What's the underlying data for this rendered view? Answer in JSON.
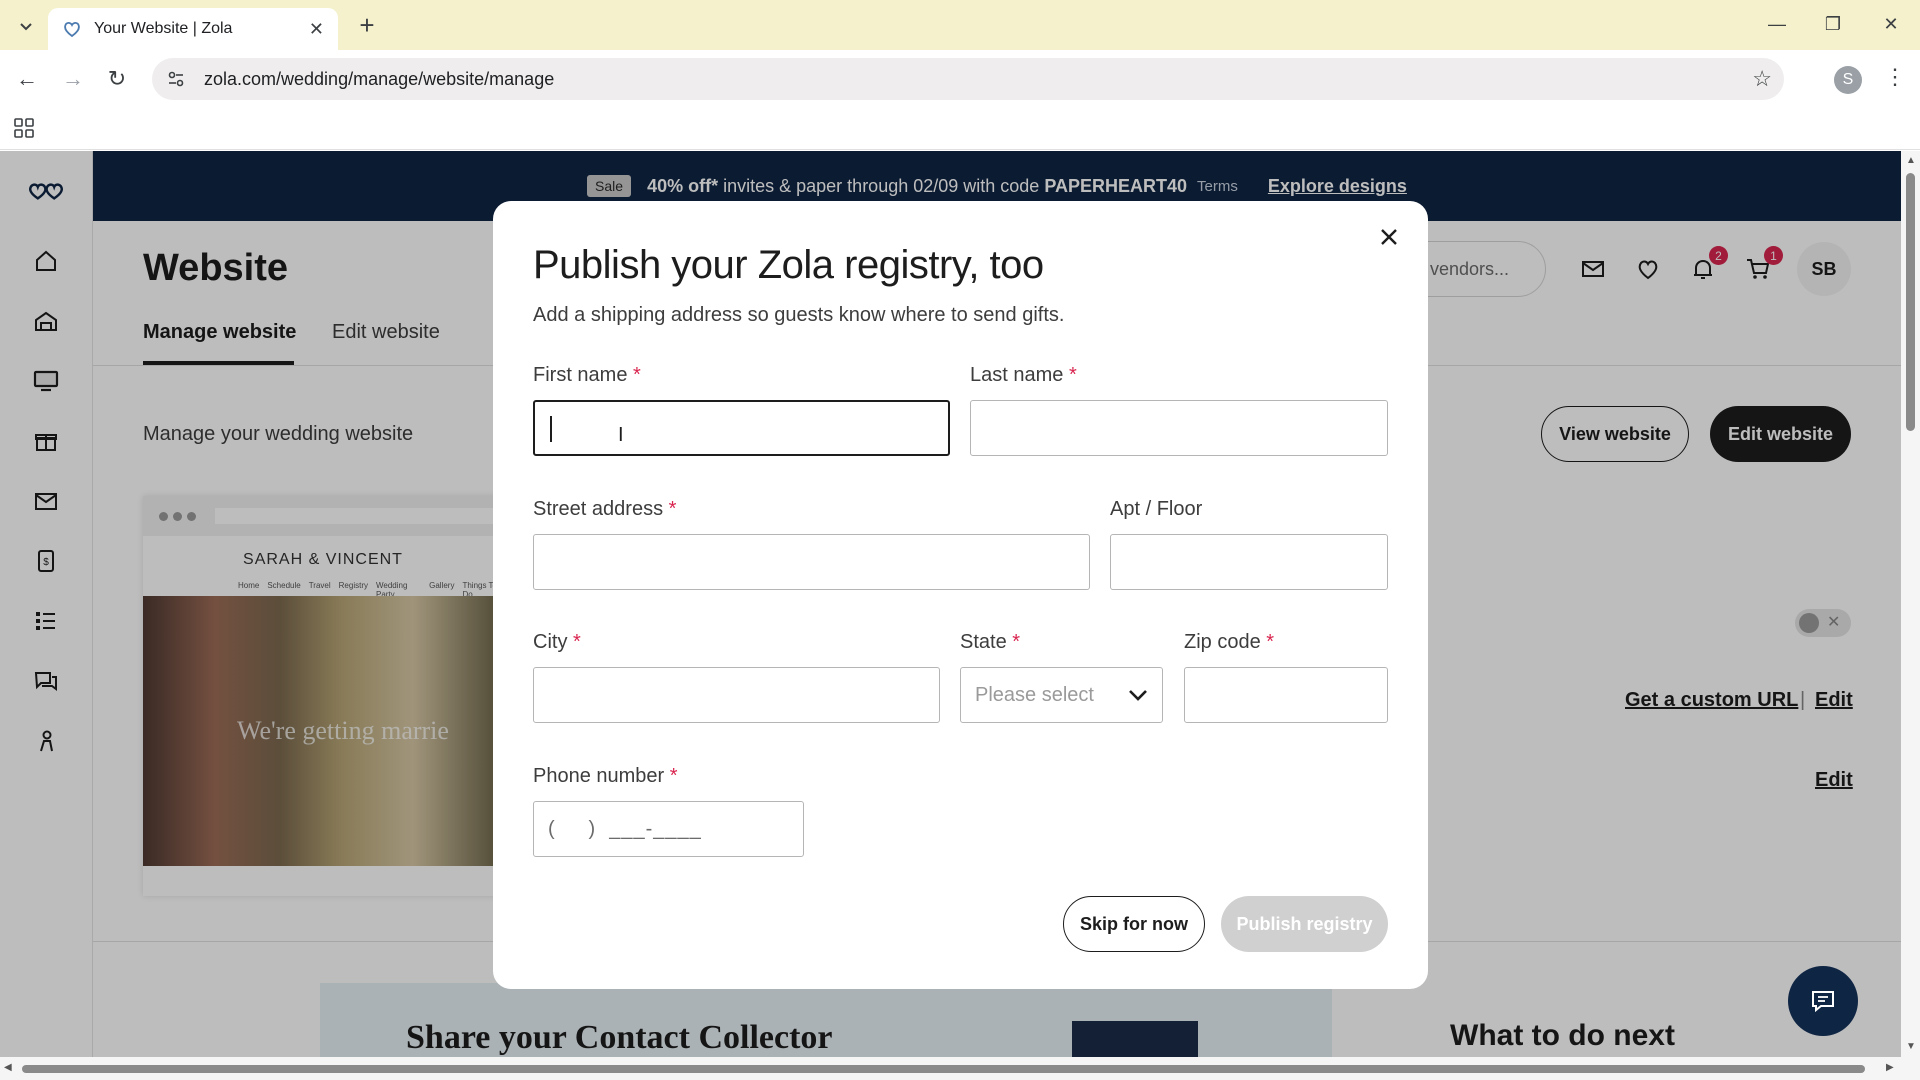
{
  "browser": {
    "tab_title": "Your Website | Zola",
    "url": "zola.com/wedding/manage/website/manage",
    "profile_initial": "S"
  },
  "promo": {
    "sale_badge": "Sale",
    "offer": "40% off*",
    "offer_rest": "invites & paper through 02/09 with code",
    "code": "PAPERHEART40",
    "terms": "Terms",
    "cta": "Explore designs"
  },
  "page": {
    "title": "Website",
    "tabs": [
      {
        "label": "Manage website"
      },
      {
        "label": "Edit website"
      }
    ],
    "manage_text": "Manage your wedding website",
    "search_placeholder": "s, vendors...",
    "notifications_count": "2",
    "cart_count": "1",
    "avatar_initials": "SB",
    "view_button": "View website",
    "edit_button": "Edit website",
    "preview": {
      "couple": "SARAH & VINCENT",
      "nav": [
        "Home",
        "Schedule",
        "Travel",
        "Registry",
        "Wedding Party",
        "Gallery",
        "Things To Do"
      ],
      "tagline": "We're getting marrie"
    },
    "custom_url_link": "Get a custom URL",
    "separator": "|",
    "edit_link": "Edit",
    "edit_link_2": "Edit",
    "contact_title": "Share your Contact Collector",
    "next_title": "What to do next"
  },
  "modal": {
    "title": "Publish your Zola registry, too",
    "subtitle": "Add a shipping address so guests know where to send gifts.",
    "fields": {
      "first_name": {
        "label": "First name",
        "value": ""
      },
      "last_name": {
        "label": "Last name",
        "value": ""
      },
      "street": {
        "label": "Street address",
        "value": ""
      },
      "apt": {
        "label": "Apt / Floor",
        "value": ""
      },
      "city": {
        "label": "City",
        "value": ""
      },
      "state": {
        "label": "State",
        "value": "Please select"
      },
      "zip": {
        "label": "Zip code",
        "value": ""
      },
      "phone": {
        "label": "Phone number",
        "mask": "(     )  ___-____"
      }
    },
    "required_mark": "*",
    "skip_button": "Skip for now",
    "publish_button": "Publish registry"
  },
  "colors": {
    "promo_bg": "#0f2544",
    "required": "#d9254f",
    "primary_btn": "#1d1d1d",
    "disabled_btn": "#d0d0d0"
  }
}
